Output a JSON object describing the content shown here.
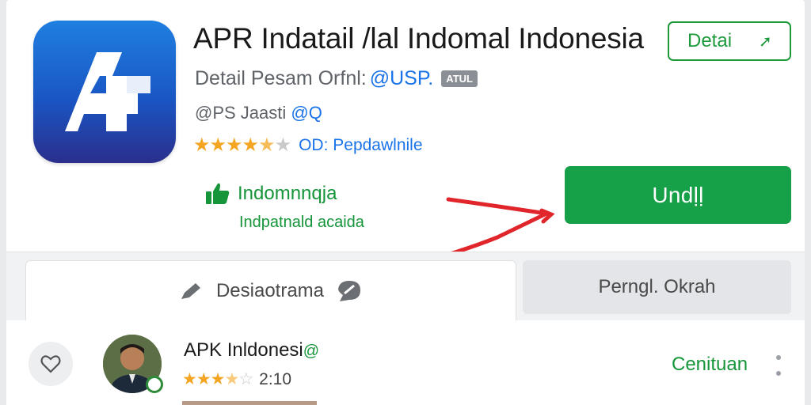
{
  "app": {
    "title": "APR Indatail /lal Indomal Indonesia",
    "developer_text": "Detail Pesam Orfnl:",
    "developer_accent": "@USP.",
    "badge": "ATUL",
    "publisher": "@PS Jaasti",
    "publisher_accent": "@Q",
    "rating_value": 4.5,
    "rating_link": "OD: Pepdawlnile",
    "icon_name": "app-logo-icon"
  },
  "actions": {
    "detail_label": "Detai",
    "install_label": "Undḷḷ",
    "promo_line1": "Indomnnqja",
    "promo_line2": "Indpatnald acaida"
  },
  "tabs": [
    {
      "label": "Desiaotrama",
      "active": true
    },
    {
      "label": "Perngl. Okrah",
      "active": false
    }
  ],
  "review": {
    "title": "APK Inldonesi",
    "title_accent": "@",
    "rating_value": 3.5,
    "rating_text": "2:10",
    "link": "Cenituan"
  },
  "colors": {
    "accent_green": "#16a048",
    "link_blue": "#1a73e8",
    "star": "#f4a623",
    "annotation_red": "#e0262b"
  }
}
